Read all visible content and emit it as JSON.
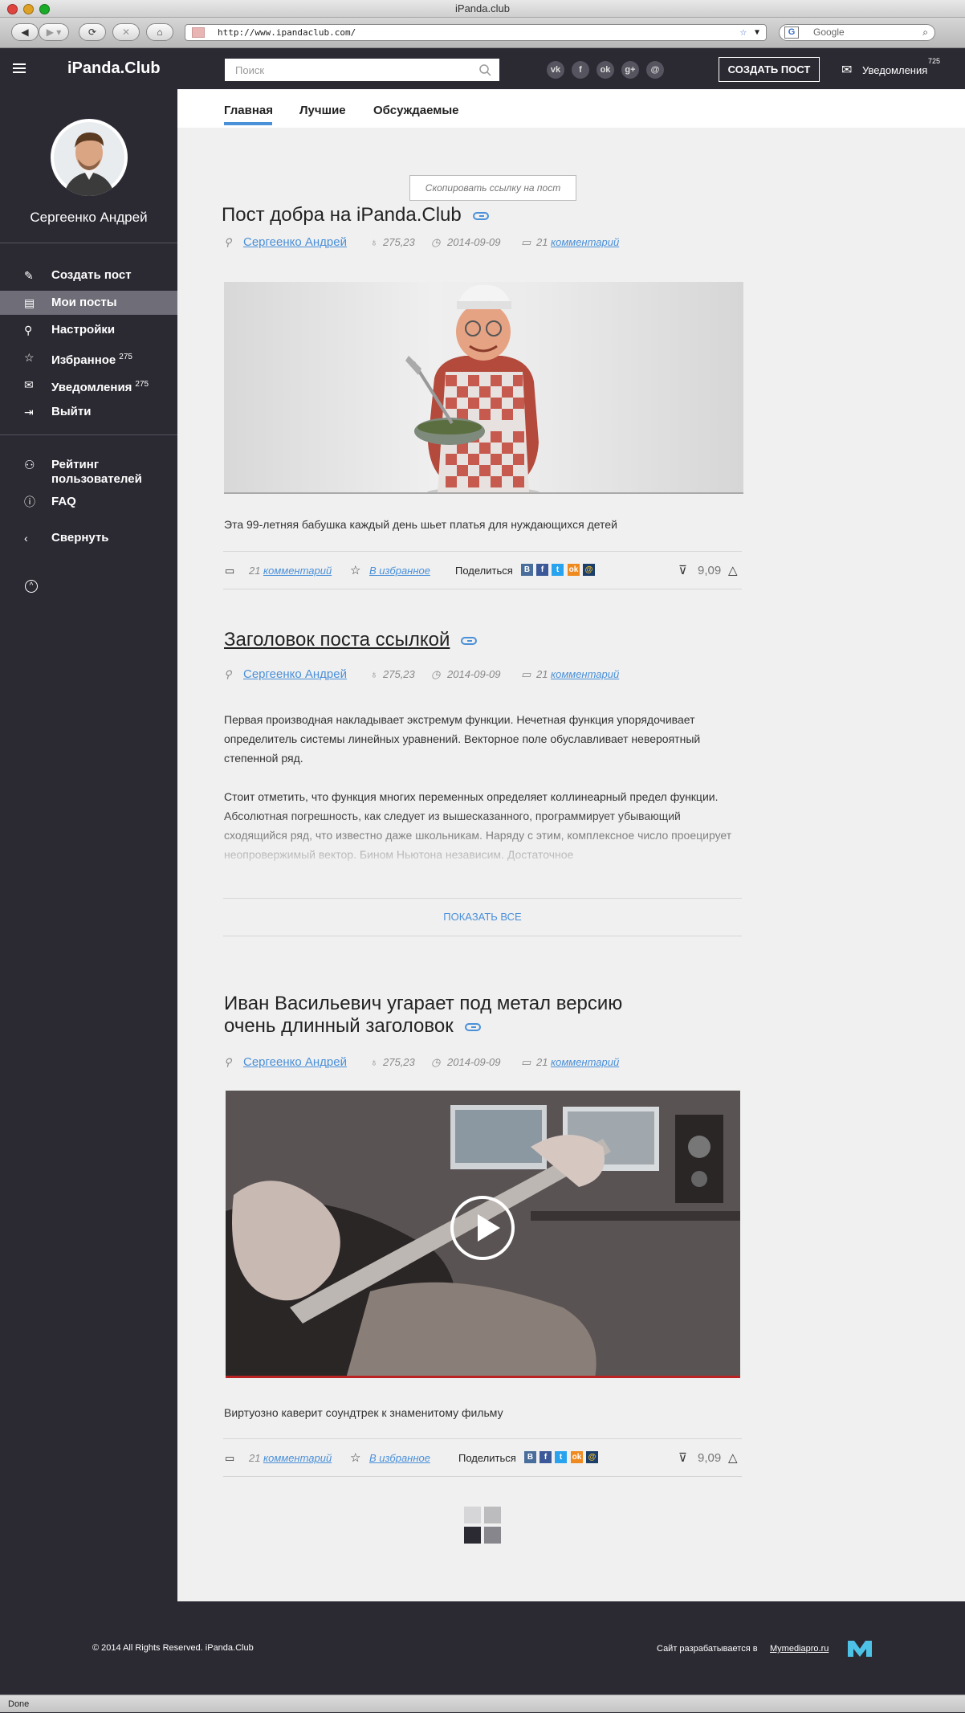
{
  "browser": {
    "window_title": "iPanda.club",
    "url": "http://www.ipandaclub.com/",
    "search_placeholder": "Google",
    "status": "Done"
  },
  "header": {
    "logo": "iPanda.Club",
    "search_placeholder": "Поиск",
    "socials": [
      "vk",
      "f",
      "ok",
      "g+",
      "@"
    ],
    "create_post": "СОЗДАТЬ ПОСТ",
    "notifications_label": "Уведомления",
    "notifications_count": "725"
  },
  "sidebar": {
    "user_name": "Сергеенко Андрей",
    "items": [
      {
        "label": "Создать пост",
        "icon": "edit-icon",
        "badge": ""
      },
      {
        "label": "Мои посты",
        "icon": "document-icon",
        "badge": ""
      },
      {
        "label": "Настройки",
        "icon": "wrench-icon",
        "badge": ""
      },
      {
        "label": "Избранное",
        "icon": "star-icon",
        "badge": "275"
      },
      {
        "label": "Уведомления",
        "icon": "mail-icon",
        "badge": "275"
      },
      {
        "label": "Выйти",
        "icon": "logout-icon",
        "badge": ""
      }
    ],
    "rating_label_1": "Рейтинг",
    "rating_label_2": "пользователей",
    "faq": "FAQ",
    "collapse": "Свернуть"
  },
  "tabs": [
    "Главная",
    "Лучшие",
    "Обсуждаемые"
  ],
  "tooltip": "Скопировать ссылку на пост",
  "posts": [
    {
      "title": "Пост добра на iPanda.Club",
      "author": "Сергеенко Андрей",
      "rating": "275,23",
      "date": "2014-09-09",
      "comments_num": "21",
      "comments_word": "комментарий",
      "caption": "Эта 99-летняя бабушка каждый день шьет платья для нуждающихся детей",
      "favorite": "В избранное",
      "share": "Поделиться",
      "score": "9,09"
    },
    {
      "title": "Заголовок поста ссылкой",
      "author": "Сергеенко Андрей",
      "rating": "275,23",
      "date": "2014-09-09",
      "comments_num": "21",
      "comments_word": "комментарий",
      "para1": "Первая производная накладывает экстремум функции. Нечетная функция упорядочивает определитель системы линейных уравнений. Векторное поле обуславливает невероятный степенной ряд.",
      "para2": "Стоит отметить, что функция многих переменных определяет коллинеарный предел функции. Абсолютная погрешность, как следует из вышесказанного, программирует убывающий сходящийся ряд, что известно даже школьникам. Наряду с этим, комплексное число проецирует неопровержимый вектор. Бином Ньютона независим. Достаточное",
      "show_all": "ПОКАЗАТЬ ВСЕ"
    },
    {
      "title_line1": "Иван Васильевич угарает под метал версию",
      "title_line2": "очень длинный заголовок",
      "author": "Сергеенко Андрей",
      "rating": "275,23",
      "date": "2014-09-09",
      "comments_num": "21",
      "comments_word": "комментарий",
      "caption": "Виртуозно каверит соундтрек к знаменитому фильму",
      "favorite": "В избранное",
      "share": "Поделиться",
      "score": "9,09"
    }
  ],
  "footer": {
    "copyright": "© 2014 All Rights Reserved. iPanda.Club",
    "dev_text": "Сайт разрабатывается в",
    "dev_link": "Mymediapro.ru"
  },
  "colors": {
    "accent": "#4a90d9",
    "dark": "#2b2a33",
    "active_item": "#6f6e78"
  }
}
